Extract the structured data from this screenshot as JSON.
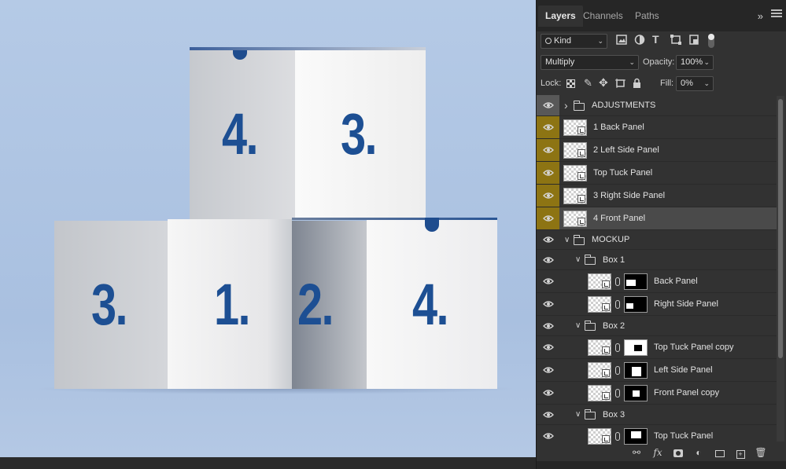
{
  "tabs": [
    {
      "label": "Layers",
      "active": true
    },
    {
      "label": "Channels",
      "active": false
    },
    {
      "label": "Paths",
      "active": false
    }
  ],
  "filter": {
    "kind_label": "Kind",
    "icons": [
      "image-filter-icon",
      "adjustment-filter-icon",
      "type-filter-icon",
      "shape-filter-icon",
      "smart-object-filter-icon"
    ]
  },
  "blend": {
    "mode": "Multiply",
    "opacity_label": "Opacity:",
    "opacity_value": "100%"
  },
  "lock": {
    "label": "Lock:",
    "fill_label": "Fill:",
    "fill_value": "0%"
  },
  "layers": [
    {
      "name": "ADJUSTMENTS",
      "type": "group",
      "indent": 0,
      "expanded": false
    },
    {
      "name": "1 Back Panel",
      "type": "smart",
      "highlight": "gold"
    },
    {
      "name": "2 Left Side Panel",
      "type": "smart",
      "highlight": "gold"
    },
    {
      "name": "Top Tuck Panel",
      "type": "smart",
      "highlight": "gold"
    },
    {
      "name": "3 Right Side Panel",
      "type": "smart",
      "highlight": "gold"
    },
    {
      "name": "4 Front Panel",
      "type": "smart",
      "highlight": "gold",
      "selected": true
    },
    {
      "name": "MOCKUP",
      "type": "group",
      "indent": 0,
      "expanded": true
    },
    {
      "name": "Box 1",
      "type": "group",
      "indent": 1,
      "expanded": true
    },
    {
      "name": "Back Panel",
      "type": "masked"
    },
    {
      "name": "Right Side Panel",
      "type": "masked"
    },
    {
      "name": "Box 2",
      "type": "group",
      "indent": 1,
      "expanded": true
    },
    {
      "name": "Top Tuck Panel copy",
      "type": "masked"
    },
    {
      "name": "Left Side Panel",
      "type": "masked"
    },
    {
      "name": "Front Panel copy",
      "type": "masked"
    },
    {
      "name": "Box 3",
      "type": "group",
      "indent": 1,
      "expanded": true
    },
    {
      "name": "Top Tuck Panel",
      "type": "masked"
    }
  ],
  "canvas": {
    "numbers": [
      "4.",
      "3.",
      "3.",
      "1.",
      "2.",
      "4."
    ],
    "colors": {
      "background": "#adc3e2",
      "number": "#1d4f93",
      "box_light": "#f2f2f2",
      "box_shade": "#b8bcc4"
    }
  },
  "footer_icons": [
    "link-layers-icon",
    "fx-icon",
    "add-mask-icon",
    "adjustment-layer-icon",
    "new-group-icon",
    "new-layer-icon",
    "delete-icon"
  ],
  "footer_fx_label": "fx"
}
